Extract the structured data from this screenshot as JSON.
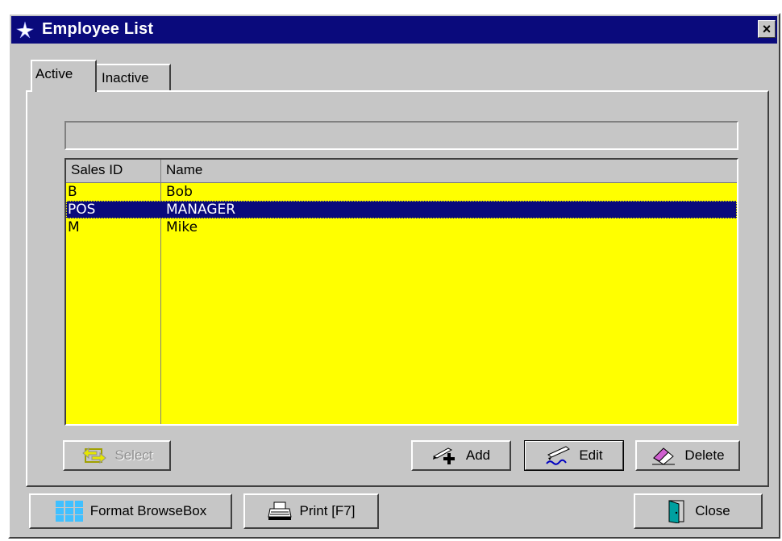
{
  "window": {
    "title": "Employee List",
    "title_icon": "app-star-icon",
    "close_icon": "close-icon",
    "close_glyph": "×"
  },
  "tabs": [
    {
      "label": "Active",
      "active": true
    },
    {
      "label": "Inactive",
      "active": false
    }
  ],
  "locator": {
    "value": ""
  },
  "browse": {
    "columns": [
      "Sales ID",
      "Name"
    ],
    "rows": [
      {
        "sales_id": "B",
        "name": "Bob",
        "selected": false
      },
      {
        "sales_id": "POS",
        "name": "MANAGER",
        "selected": true
      },
      {
        "sales_id": "M",
        "name": "Mike",
        "selected": false
      }
    ],
    "background": "#ffff00",
    "selection_color": "#0a0a7c"
  },
  "buttons": {
    "select": {
      "label": "Select",
      "icon": "select-arrow-icon",
      "enabled": false
    },
    "add": {
      "label": "Add",
      "icon": "add-pencil-icon"
    },
    "edit": {
      "label": "Edit",
      "icon": "edit-pen-icon"
    },
    "delete": {
      "label": "Delete",
      "icon": "eraser-icon"
    },
    "format": {
      "label": "Format BrowseBox",
      "icon": "grid-icon"
    },
    "print": {
      "label": "Print [F7]",
      "icon": "printer-icon"
    },
    "close": {
      "label": "Close",
      "icon": "door-icon"
    }
  },
  "colors": {
    "titlebar": "#0a0a7c",
    "face": "#c6c6c6"
  }
}
